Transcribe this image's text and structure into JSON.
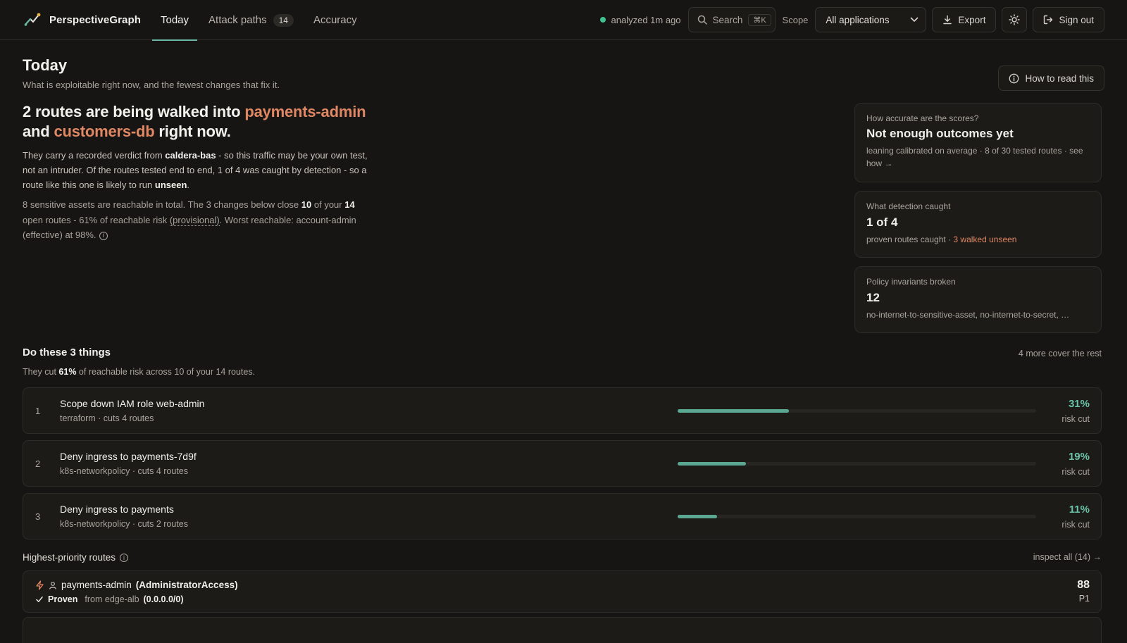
{
  "app": {
    "name": "PerspectiveGraph"
  },
  "nav": {
    "tabs": [
      {
        "label": "Today"
      },
      {
        "label": "Attack paths",
        "badge": "14"
      },
      {
        "label": "Accuracy"
      }
    ]
  },
  "topbar": {
    "status": "analyzed 1m ago",
    "search_label": "Search",
    "search_shortcut": "⌘K",
    "scope_label": "Scope",
    "scope_value": "All applications",
    "export_label": "Export",
    "signout_label": "Sign out"
  },
  "header": {
    "title": "Today",
    "subtitle": "What is exploitable right now, and the fewest changes that fix it.",
    "howto_label": "How to read this"
  },
  "hero": {
    "headline_pre": "2 routes are being walked into ",
    "target_1": "payments-admin",
    "headline_mid": "and ",
    "target_2": "customers-db",
    "headline_post": " right now.",
    "p1_pre": "They carry a recorded verdict from ",
    "p1_source": "caldera-bas",
    "p1_mid": " - so this traffic may be your own test, not an intruder. Of the routes tested end to end, 1 of 4 was caught by detection - so a route like this one is likely to run ",
    "p1_unseen": "unseen",
    "p1_end": ".",
    "p2_pre": "8 sensitive assets are reachable in total. The 3 changes below close ",
    "p2_closed": "10",
    "p2_mid": " of your ",
    "p2_total": "14",
    "p2_after": " open routes - 61% of reachable risk ",
    "p2_provisional": "(provisional)",
    "p2_end": ". Worst reachable: account-admin (effective) at 98%."
  },
  "cards": {
    "accuracy": {
      "label": "How accurate are the scores?",
      "title": "Not enough outcomes yet",
      "note": "leaning calibrated on average · 8 of 30 tested routes · see how →"
    },
    "detection": {
      "label": "What detection caught",
      "value": "1 of 4",
      "note_pre": "proven routes caught · ",
      "note_warn": "3 walked unseen"
    },
    "policy": {
      "label": "Policy invariants broken",
      "value": "12",
      "note": "no-internet-to-sensitive-asset, no-internet-to-secret, …"
    }
  },
  "fixes": {
    "title": "Do these 3 things",
    "right": "4 more cover the rest",
    "sub_pre": "They cut ",
    "sub_pct": "61%",
    "sub_post": " of reachable risk across 10 of your 14 routes.",
    "items": [
      {
        "num": "1",
        "title": "Scope down IAM role web-admin",
        "meta": "terraform · cuts 4 routes",
        "pct": "31%",
        "fraction": 0.31,
        "cut_label": "risk cut"
      },
      {
        "num": "2",
        "title": "Deny ingress to payments-7d9f",
        "meta": "k8s-networkpolicy · cuts 4 routes",
        "pct": "19%",
        "fraction": 0.19,
        "cut_label": "risk cut"
      },
      {
        "num": "3",
        "title": "Deny ingress to payments",
        "meta": "k8s-networkpolicy · cuts 2 routes",
        "pct": "11%",
        "fraction": 0.11,
        "cut_label": "risk cut"
      }
    ]
  },
  "routes": {
    "title": "Highest-priority routes",
    "link": "inspect all (14) →",
    "items": [
      {
        "target": "payments-admin",
        "role": "(AdministratorAccess)",
        "status": "Proven",
        "from": "from edge-alb",
        "cidr": "(0.0.0.0/0)",
        "score": "88",
        "priority": "P1"
      }
    ]
  },
  "colors": {
    "accent": "#6ab8a4",
    "warn": "#e08763",
    "status_ok": "#3fc28f",
    "background": "#161513"
  }
}
